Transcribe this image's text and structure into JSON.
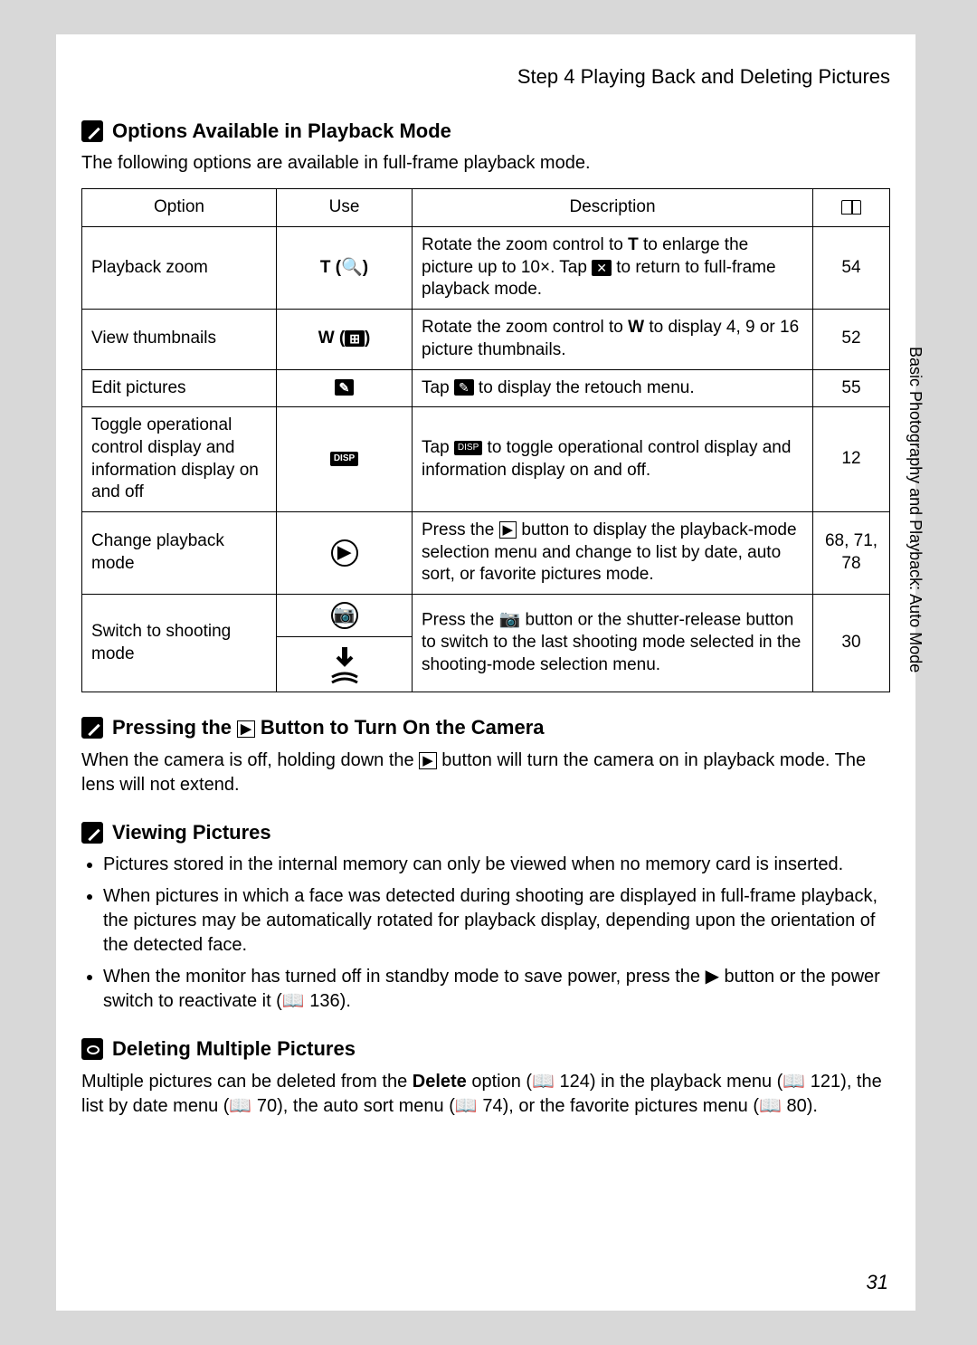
{
  "header": {
    "step": "Step 4 Playing Back and Deleting Pictures"
  },
  "section1": {
    "title": "Options Available in Playback Mode",
    "intro": "The following options are available in full-frame playback mode."
  },
  "table": {
    "headers": {
      "option": "Option",
      "use": "Use",
      "description": "Description"
    },
    "rows": [
      {
        "option": "Playback zoom",
        "use_label": "T-zoom-in-icon",
        "desc_pre": "Rotate the zoom control to ",
        "desc_bold1": "T",
        "desc_mid1": " to enlarge the picture up to 10×.\nTap ",
        "desc_icon": "x-close-icon",
        "desc_post": " to return to full-frame playback mode.",
        "page": "54"
      },
      {
        "option": "View thumbnails",
        "use_label": "W-thumbnails-icon",
        "desc_pre": "Rotate the zoom control to ",
        "desc_bold1": "W",
        "desc_post": " to display 4, 9 or 16 picture thumbnails.",
        "page": "52"
      },
      {
        "option": "Edit pictures",
        "use_label": "retouch-icon",
        "desc_pre": "Tap ",
        "desc_icon": "retouch-icon",
        "desc_post": " to display the retouch menu.",
        "page": "55"
      },
      {
        "option": "Toggle operational control display and information display on and off",
        "use_label": "disp-icon",
        "desc_pre": "Tap ",
        "desc_icon": "disp-icon",
        "desc_post": " to toggle operational control display and information display on and off.",
        "page": "12"
      },
      {
        "option": "Change playback mode",
        "use_label": "playback-button-icon",
        "desc_pre": "Press the ",
        "desc_icon": "playback-outline-icon",
        "desc_post": " button to display the playback-mode selection menu and change to list by date, auto sort, or favorite pictures mode.",
        "page": "68, 71, 78"
      },
      {
        "option": "Switch to shooting mode",
        "use_label": "camera-shutter-icons",
        "desc_pre": "Press the ",
        "desc_icon": "camera-icon",
        "desc_post": " button or the shutter-release button to switch to the last shooting mode selected in the shooting-mode selection menu.",
        "page": "30"
      }
    ]
  },
  "section2": {
    "title_pre": "Pressing the ",
    "title_post": " Button to Turn On the Camera",
    "body_pre": "When the camera is off, holding down the ",
    "body_post": " button will turn the camera on in playback mode. The lens will not extend."
  },
  "section3": {
    "title": "Viewing Pictures",
    "bullets": [
      "Pictures stored in the internal memory can only be viewed when no memory card is inserted.",
      "When pictures in which a face was detected during shooting are displayed in full-frame playback, the pictures may be automatically rotated for playback display, depending upon the orientation of the detected face.",
      "When the monitor has turned off in standby mode to save power, press the ▶ button or the power switch to reactivate it (📖 136)."
    ]
  },
  "section4": {
    "title": "Deleting Multiple Pictures",
    "body_pre": "Multiple pictures can be deleted from the ",
    "body_bold": "Delete",
    "body_post": " option (📖 124) in the playback menu (📖 121), the list by date menu (📖 70), the auto sort menu (📖 74), or the favorite pictures menu (📖 80)."
  },
  "sidebar": "Basic Photography and Playback: Auto Mode",
  "page_number": "31"
}
